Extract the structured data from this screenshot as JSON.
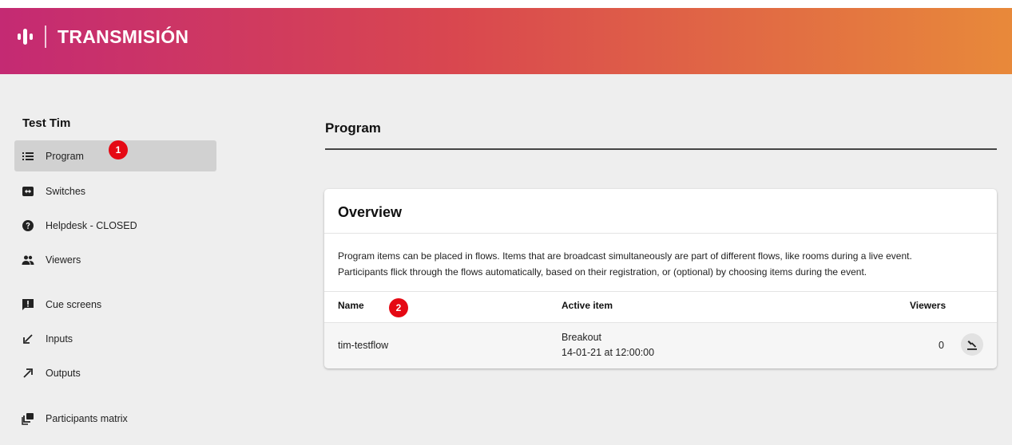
{
  "brand": {
    "name": "TRANSMISIÓN",
    "logo_icon": "waveform-logo-icon"
  },
  "colors": {
    "gradient_start": "#c42a73",
    "gradient_mid": "#d9474f",
    "gradient_end": "#e8893a",
    "badge": "#e50914"
  },
  "sidebar": {
    "event_title": "Test Tim",
    "items": [
      {
        "label": "Program",
        "icon": "list-icon",
        "active": true
      },
      {
        "label": "Switches",
        "icon": "switch-arrows-icon"
      },
      {
        "label": "Helpdesk - CLOSED",
        "icon": "help-circle-icon"
      },
      {
        "label": "Viewers",
        "icon": "people-icon"
      },
      {
        "label": "Cue screens",
        "icon": "alert-message-icon"
      },
      {
        "label": "Inputs",
        "icon": "arrow-down-left-icon"
      },
      {
        "label": "Outputs",
        "icon": "arrow-up-right-icon"
      },
      {
        "label": "Participants matrix",
        "icon": "participants-matrix-icon"
      }
    ]
  },
  "annotations": {
    "badge1": "1",
    "badge2": "2"
  },
  "main": {
    "title": "Program",
    "overview": {
      "title": "Overview",
      "description_line1": "Program items can be placed in flows. Items that are broadcast simultaneously are part of different flows, like rooms during a live event.",
      "description_line2": "Participants flick through the flows automatically, based on their registration, or (optional) by choosing items during the event.",
      "columns": {
        "name": "Name",
        "active_item": "Active item",
        "viewers": "Viewers"
      },
      "rows": [
        {
          "name": "tim-testflow",
          "active_item": "Breakout",
          "active_time": "14-01-21 at 12:00:00",
          "viewers": "0",
          "action_icon": "gavel-switch-icon"
        }
      ]
    }
  }
}
